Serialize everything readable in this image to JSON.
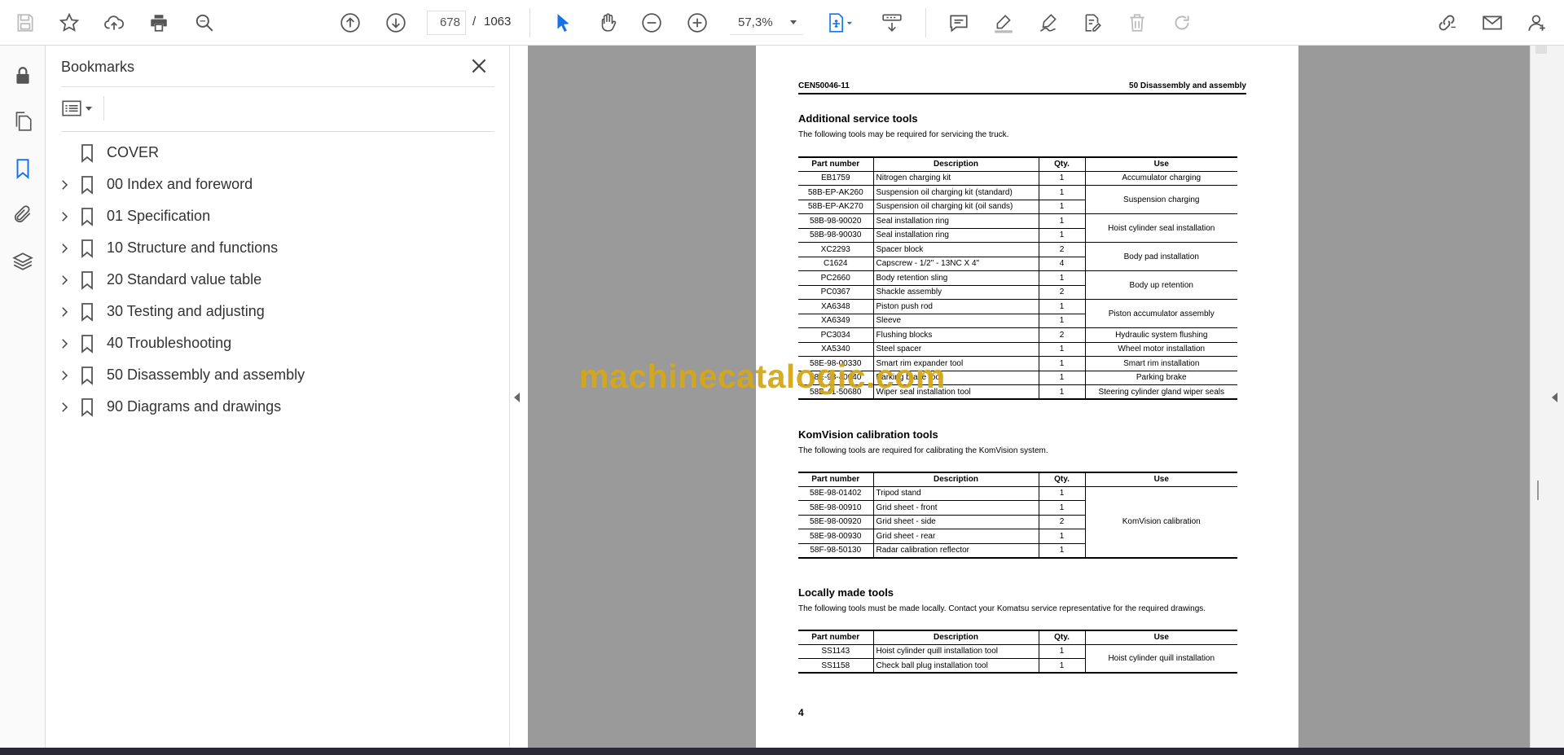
{
  "toolbar": {
    "current_page": "678",
    "page_separator": "/",
    "total_pages": "1063",
    "zoom": "57,3%"
  },
  "bookmarks_panel": {
    "title": "Bookmarks",
    "items": [
      {
        "label": "COVER",
        "expandable": false
      },
      {
        "label": "00 Index and foreword",
        "expandable": true
      },
      {
        "label": "01 Specification",
        "expandable": true
      },
      {
        "label": "10 Structure and functions",
        "expandable": true
      },
      {
        "label": "20 Standard value table",
        "expandable": true
      },
      {
        "label": "30 Testing and adjusting",
        "expandable": true
      },
      {
        "label": "40 Troubleshooting",
        "expandable": true
      },
      {
        "label": "50 Disassembly and assembly",
        "expandable": true
      },
      {
        "label": "90 Diagrams and drawings",
        "expandable": true
      }
    ]
  },
  "document": {
    "header_left": "CEN50046-11",
    "header_right": "50 Disassembly and assembly",
    "columns": {
      "part": "Part number",
      "desc": "Description",
      "qty": "Qty.",
      "use": "Use"
    },
    "sections": [
      {
        "title": "Additional service tools",
        "intro": "The following tools may be required for servicing the truck.",
        "rows": [
          {
            "part": "EB1759",
            "desc": "Nitrogen charging kit",
            "qty": "1"
          },
          {
            "part": "58B-EP-AK260",
            "desc": "Suspension oil charging kit (standard)",
            "qty": "1"
          },
          {
            "part": "58B-EP-AK270",
            "desc": "Suspension oil charging kit (oil sands)",
            "qty": "1"
          },
          {
            "part": "58B-98-90020",
            "desc": "Seal installation ring",
            "qty": "1"
          },
          {
            "part": "58B-98-90030",
            "desc": "Seal installation ring",
            "qty": "1"
          },
          {
            "part": "XC2293",
            "desc": "Spacer block",
            "qty": "2"
          },
          {
            "part": "C1624",
            "desc": "Capscrew - 1/2\" - 13NC X 4\"",
            "qty": "4"
          },
          {
            "part": "PC2660",
            "desc": "Body retention sling",
            "qty": "1"
          },
          {
            "part": "PC0367",
            "desc": "Shackle assembly",
            "qty": "2"
          },
          {
            "part": "XA6348",
            "desc": "Piston push rod",
            "qty": "1"
          },
          {
            "part": "XA6349",
            "desc": "Sleeve",
            "qty": "1"
          },
          {
            "part": "PC3034",
            "desc": "Flushing blocks",
            "qty": "2"
          },
          {
            "part": "XA5340",
            "desc": "Steel spacer",
            "qty": "1"
          },
          {
            "part": "58E-98-00330",
            "desc": "Smart rim expander tool",
            "qty": "1"
          },
          {
            "part": "58E-98-40040",
            "desc": "Parking brake tool",
            "qty": "1"
          },
          {
            "part": "58B-41-50680",
            "desc": "Wiper seal installation tool",
            "qty": "1"
          }
        ],
        "use_groups": [
          {
            "label": "Accumulator charging",
            "rows": 1
          },
          {
            "label": "Suspension charging",
            "rows": 2
          },
          {
            "label": "Hoist cylinder seal installation",
            "rows": 2
          },
          {
            "label": "Body pad installation",
            "rows": 2
          },
          {
            "label": "Body up retention",
            "rows": 2
          },
          {
            "label": "Piston accumulator assembly",
            "rows": 2
          },
          {
            "label": "Hydraulic system flushing",
            "rows": 1
          },
          {
            "label": "Wheel motor installation",
            "rows": 1
          },
          {
            "label": "Smart rim installation",
            "rows": 1
          },
          {
            "label": "Parking brake",
            "rows": 1
          },
          {
            "label": "Steering cylinder gland wiper seals",
            "rows": 1
          }
        ]
      },
      {
        "title": "KomVision calibration tools",
        "intro": "The following tools are required for calibrating the KomVision system.",
        "rows": [
          {
            "part": "58E-98-01402",
            "desc": "Tripod stand",
            "qty": "1"
          },
          {
            "part": "58E-98-00910",
            "desc": "Grid sheet - front",
            "qty": "1"
          },
          {
            "part": "58E-98-00920",
            "desc": "Grid sheet - side",
            "qty": "2"
          },
          {
            "part": "58E-98-00930",
            "desc": "Grid sheet - rear",
            "qty": "1"
          },
          {
            "part": "58F-98-50130",
            "desc": "Radar calibration reflector",
            "qty": "1"
          }
        ],
        "use_groups": [
          {
            "label": "KomVision calibration",
            "rows": 5
          }
        ]
      },
      {
        "title": "Locally made tools",
        "intro": "The following tools must be made locally. Contact your Komatsu service representative for the required drawings.",
        "rows": [
          {
            "part": "SS1143",
            "desc": "Hoist cylinder quill installation tool",
            "qty": "1"
          },
          {
            "part": "SS1158",
            "desc": "Check ball plug installation tool",
            "qty": "1"
          }
        ],
        "use_groups": [
          {
            "label": "Hoist cylinder quill installation",
            "rows": 2
          }
        ]
      }
    ],
    "page_number": "4"
  },
  "watermark": "machinecatalogic.com"
}
